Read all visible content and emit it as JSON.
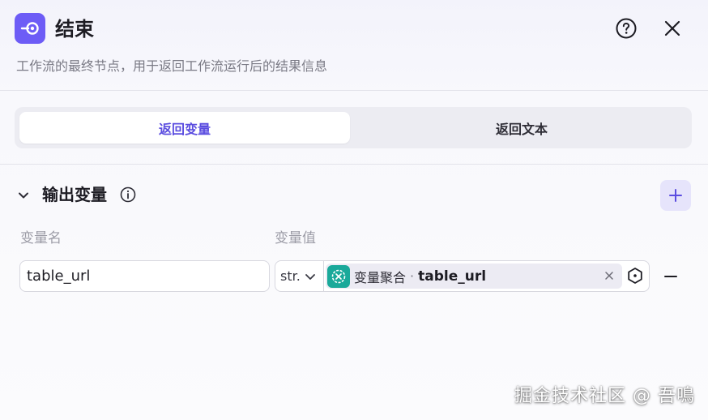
{
  "header": {
    "title": "结束",
    "description": "工作流的最终节点，用于返回工作流运行后的结果信息",
    "node_icon": "end-node-icon",
    "help_icon": "question-circle-icon",
    "close_icon": "close-icon"
  },
  "tabs": [
    {
      "label": "返回变量",
      "active": true
    },
    {
      "label": "返回文本",
      "active": false
    }
  ],
  "section": {
    "title": "输出变量",
    "collapse_icon": "chevron-down-icon",
    "info_icon": "info-icon",
    "add_icon": "plus-icon"
  },
  "columns": {
    "name": "变量名",
    "value": "变量值"
  },
  "rows": [
    {
      "name": "table_url",
      "type": "str.",
      "source_node": "变量聚合",
      "separator": "·",
      "variable": "table_url"
    }
  ],
  "watermark": "掘金技术社区 @ 吾鳴",
  "colors": {
    "accent": "#6d5cf6",
    "accent_text": "#5b4de0",
    "node_tag": "#1aa99a"
  }
}
